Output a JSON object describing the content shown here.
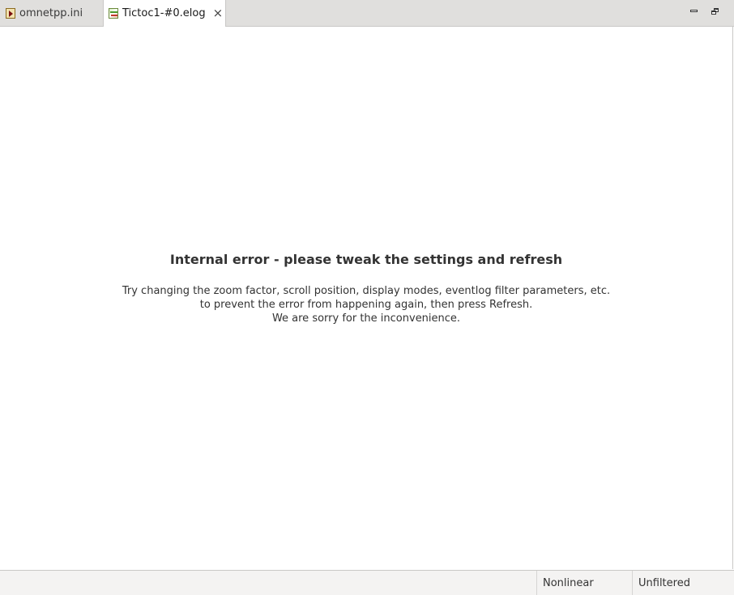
{
  "tabs": [
    {
      "label": "omnetpp.ini",
      "icon": "ini-file-icon",
      "active": false
    },
    {
      "label": "Tictoc1-#0.elog",
      "icon": "eventlog-file-icon",
      "active": true,
      "close_icon": "close-icon"
    }
  ],
  "window_controls": {
    "minimize_icon": "minimize-icon",
    "restore_icon": "restore-icon"
  },
  "error": {
    "title": "Internal error - please tweak the settings and refresh",
    "line1": "Try changing the zoom factor, scroll position, display modes, eventlog filter parameters, etc.",
    "line2": "to prevent the error from happening again, then press Refresh.",
    "line3": "We are sorry for the inconvenience."
  },
  "status": {
    "timeline_mode": "Nonlinear",
    "filter_state": "Unfiltered"
  }
}
